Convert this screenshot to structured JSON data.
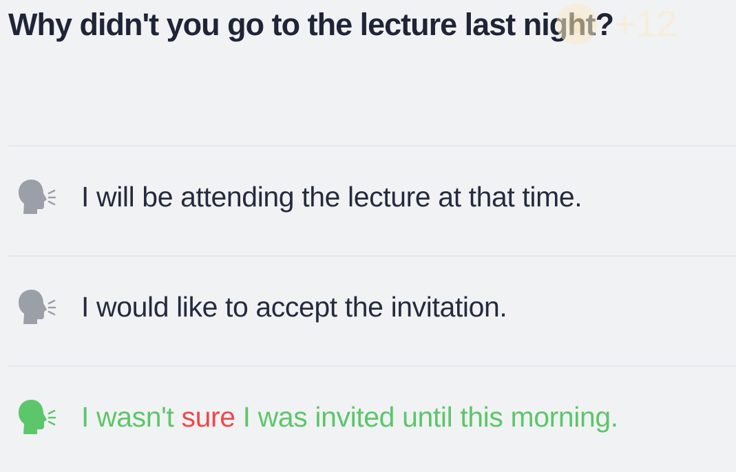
{
  "question": {
    "text": "Why didn't you go to the lecture last night?"
  },
  "xp_badge": {
    "label": "+12"
  },
  "options": [
    {
      "text": "I will be attending the lecture at that time.",
      "state": "neutral",
      "icon": "speaking-head-icon"
    },
    {
      "text": "I would like to accept the invitation.",
      "state": "neutral",
      "icon": "speaking-head-icon"
    },
    {
      "state": "correct",
      "icon": "speaking-head-icon",
      "segments": {
        "before": "I wasn't ",
        "highlight": "sure",
        "after": " I was invited until this morning."
      }
    }
  ],
  "colors": {
    "background": "#f1f2f4",
    "text": "#252b3e",
    "neutral_icon": "#9ba0a8",
    "correct": "#5cc66a",
    "highlight": "#f0484a",
    "divider": "#e4e6ea"
  }
}
